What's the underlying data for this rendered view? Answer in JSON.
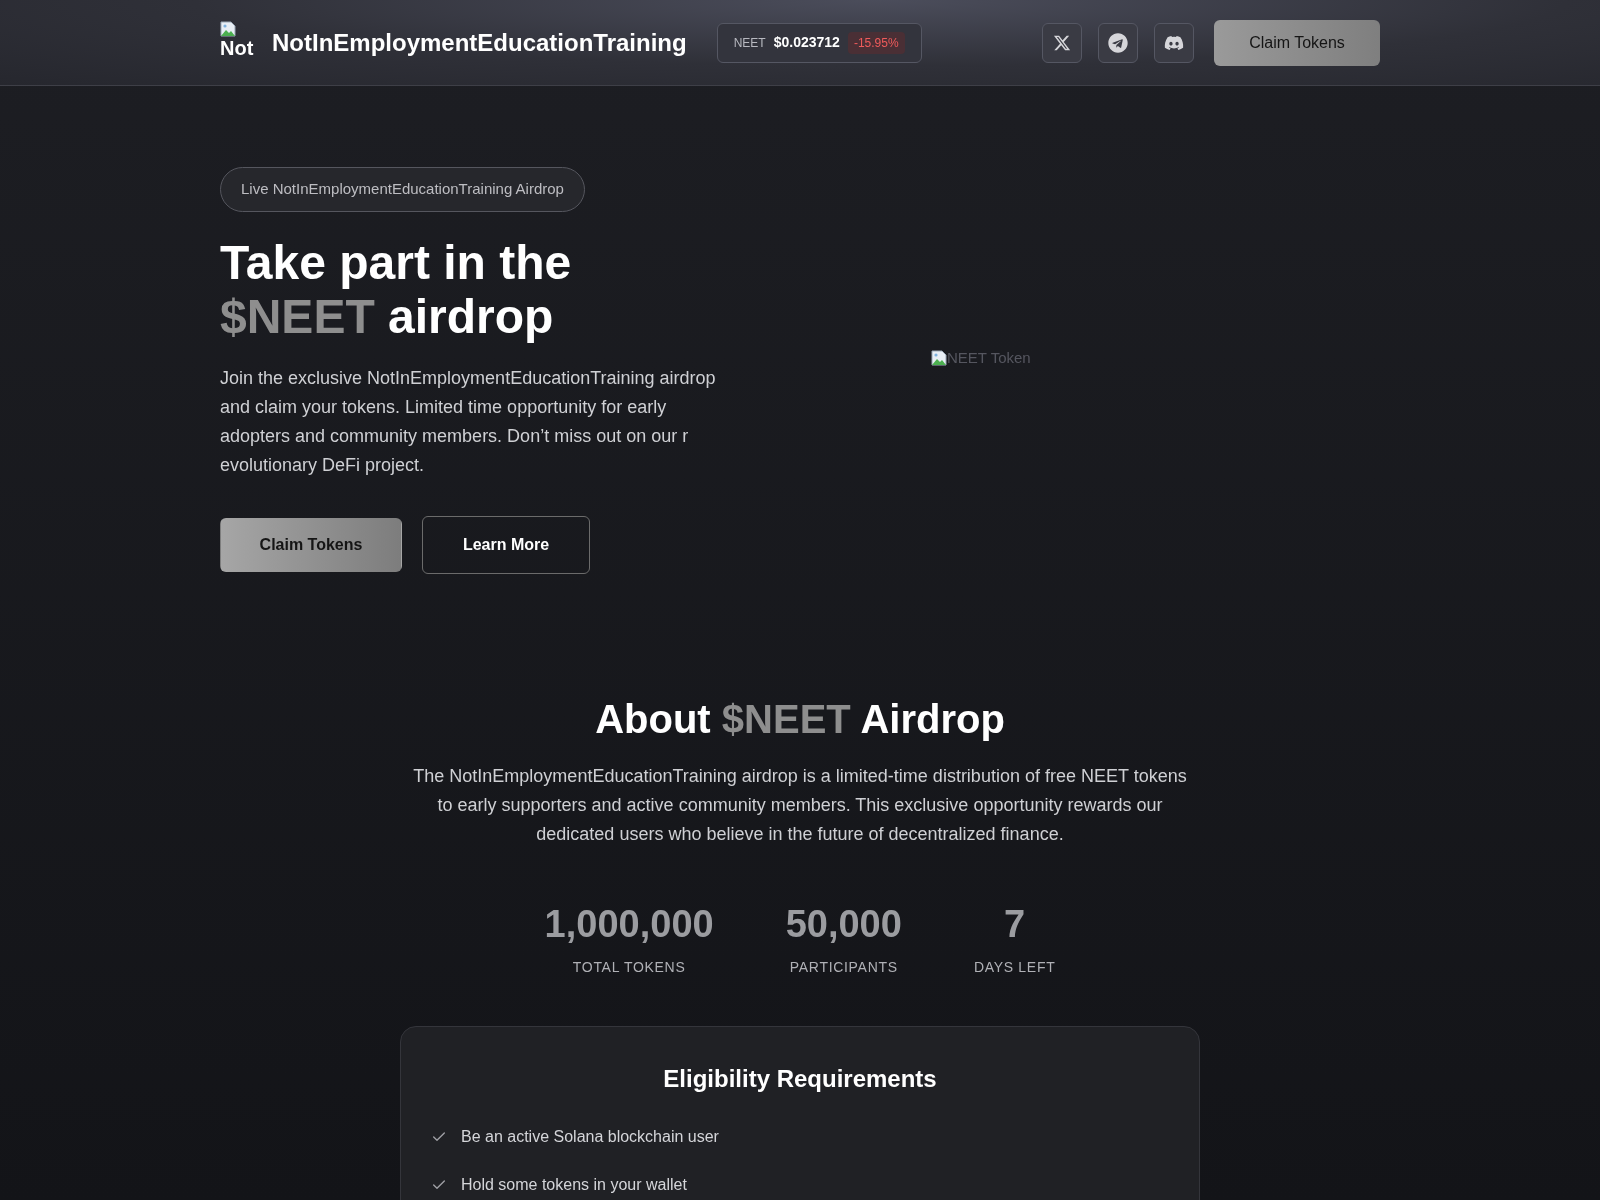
{
  "header": {
    "logo_alt": "Not",
    "brand": "NotInEmploymentEducationTraining",
    "ticker": {
      "symbol": "NEET",
      "price": "$0.023712",
      "change": "-15.95%",
      "negative": true
    },
    "cta": "Claim Tokens"
  },
  "hero": {
    "badge": "Live NotInEmploymentEducationTraining Airdrop",
    "title_lines": [
      [
        {
          "text": "Take part in the",
          "accent": false
        }
      ],
      [
        {
          "text": "$NEET",
          "accent": true
        },
        {
          "text": "airdrop",
          "accent": false
        }
      ]
    ],
    "description_lines": [
      "Join the exclusive NotInEmploymentEducationTraining airdrop",
      "and claim your tokens. Limited time opportunity for early",
      "adopters and community members. Don’t miss out on our r",
      "evolutionary DeFi project."
    ],
    "buttons": [
      {
        "label": "Claim Tokens",
        "kind": "primary"
      },
      {
        "label": "Learn More",
        "kind": "outline"
      }
    ],
    "image_alt": "NEET Token"
  },
  "about": {
    "title": [
      {
        "text": "About",
        "accent": false
      },
      {
        "text": "$NEET",
        "accent": true
      },
      {
        "text": "Airdrop",
        "accent": false
      }
    ],
    "description_lines": [
      "The NotInEmploymentEducationTraining airdrop is a limited-time distribution of free NEET tokens",
      "to early supporters and active community members. This exclusive opportunity rewards our",
      "dedicated users who believe in the future of decentralized finance."
    ],
    "stats": [
      {
        "value": "1,000,000",
        "label": "TOTAL TOKENS"
      },
      {
        "value": "50,000",
        "label": "PARTICIPANTS"
      },
      {
        "value": "7",
        "label": "DAYS LEFT"
      }
    ]
  },
  "eligibility": {
    "title": "Eligibility Requirements",
    "items": [
      "Be an active Solana blockchain user",
      "Hold some tokens in your wallet"
    ]
  }
}
